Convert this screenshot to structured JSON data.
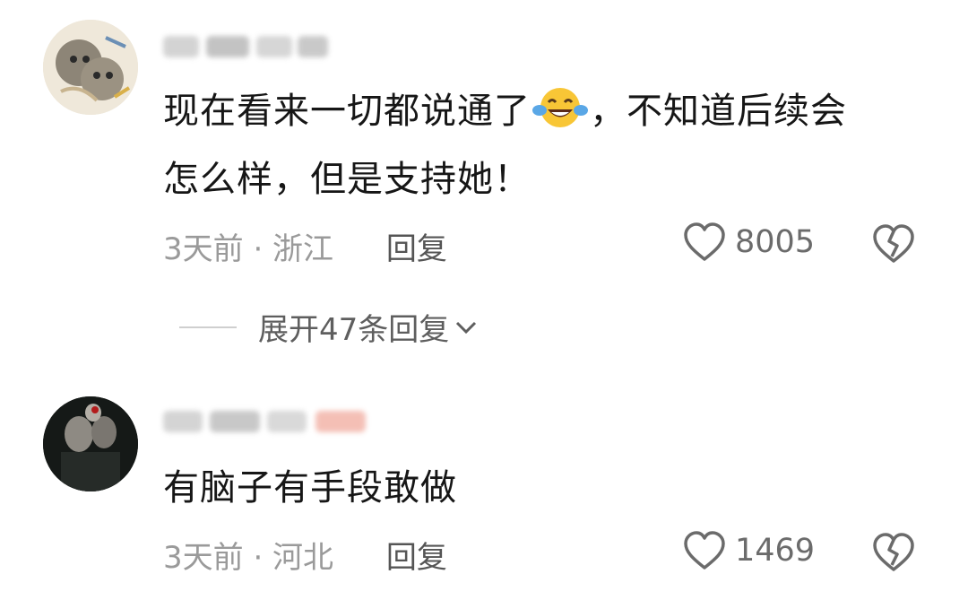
{
  "comments": [
    {
      "text_line1_before_emoji": "现在看来一切都说通了",
      "emoji": "face-with-tears-of-joy-icon",
      "text_line1_after_emoji": "，不知道后续会",
      "text_line2": "怎么样，但是支持她！",
      "time_location": "3天前 · 浙江",
      "reply_label": "回复",
      "likes": "8005",
      "expand_replies": "展开47条回复"
    },
    {
      "text_line1": "有脑子有手段敢做",
      "time_location": "3天前 · 河北",
      "reply_label": "回复",
      "likes": "1469"
    }
  ],
  "colors": {
    "text": "#161616",
    "meta": "#9a9a9a",
    "reply": "#555555",
    "icon": "#6b6b6b"
  }
}
